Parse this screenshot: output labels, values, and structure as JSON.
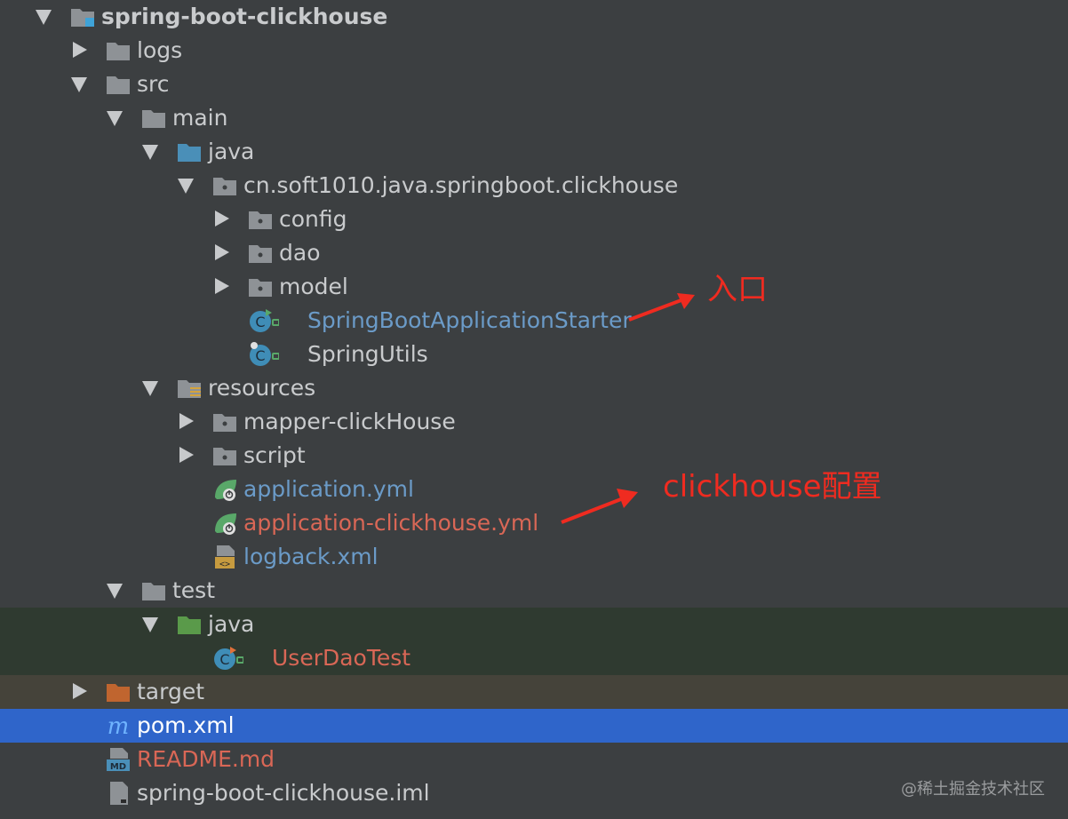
{
  "tree": {
    "root": "spring-boot-clickhouse",
    "logs": "logs",
    "src": "src",
    "main": "main",
    "java": "java",
    "package": "cn.soft1010.java.springboot.clickhouse",
    "config": "config",
    "dao": "dao",
    "model": "model",
    "starter": "SpringBootApplicationStarter",
    "utils": "SpringUtils",
    "resources": "resources",
    "mapper": "mapper-clickHouse",
    "script": "script",
    "app_yml": "application.yml",
    "app_ch_yml": "application-clickhouse.yml",
    "logback": "logback.xml",
    "test": "test",
    "test_java": "java",
    "user_dao_test": "UserDaoTest",
    "target": "target",
    "pom": "pom.xml",
    "readme": "README.md",
    "iml": "spring-boot-clickhouse.iml"
  },
  "annotations": {
    "entry": "入口",
    "config": "clickhouse配置"
  },
  "watermark": "@稀土掘金技术社区",
  "colors": {
    "background": "#3c3f41",
    "selected": "#2f65ca",
    "text": "#c9cbcd",
    "blue_text": "#6b9bc8",
    "red_text": "#d96756",
    "annotation": "#ef2b20",
    "folder": "#8e9296"
  },
  "icons": {
    "folder": "folder-icon",
    "source_folder": "source-folder-icon",
    "test_folder": "test-folder-icon",
    "excluded_folder": "excluded-folder-icon",
    "package": "package-icon",
    "class": "class-icon",
    "spring_config": "spring-config-icon",
    "xml": "xml-file-icon",
    "maven": "maven-icon",
    "markdown": "markdown-icon",
    "file": "file-icon"
  }
}
